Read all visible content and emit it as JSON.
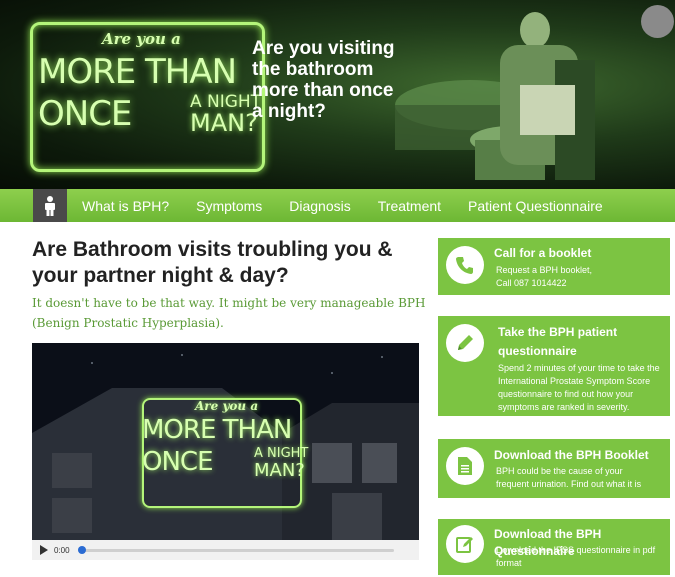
{
  "hero": {
    "slogan_small": "Are you a",
    "slogan_line1": "MORE THAN",
    "slogan_line2": "ONCE",
    "slogan_anight": "A NIGHT",
    "slogan_man": "MAN?",
    "question": "Are you visiting the bathroom more than once a night?"
  },
  "nav": {
    "home_icon": "person-icon",
    "items": [
      {
        "label": "What is BPH?"
      },
      {
        "label": "Symptoms"
      },
      {
        "label": "Diagnosis"
      },
      {
        "label": "Treatment"
      },
      {
        "label": "Patient Questionnaire"
      }
    ]
  },
  "main": {
    "headline": "Are Bathroom visits troubling you & your partner night & day?",
    "subline": "It doesn't have to be that way. It might be very manageable BPH (Benign Prostatic Hyperplasia).",
    "video": {
      "slogan_small": "Are you a",
      "slogan_line1": "MORE THAN",
      "slogan_line2": "ONCE",
      "slogan_anight": "A NIGHT",
      "slogan_man": "MAN?",
      "time": "0:00",
      "progress": 0
    }
  },
  "sidebar": {
    "cards": [
      {
        "icon": "phone-icon",
        "title": "Call for a booklet",
        "body_line1": "Request a BPH booklet,",
        "body_line2": "Call 087 1014422"
      },
      {
        "icon": "pencil-icon",
        "title_line1": "Take the BPH patient",
        "title_line2": "questionnaire",
        "body": "Spend 2 minutes of your time to take the International Prostate Symptom Score questionnaire to find out how your symptoms are ranked in severity."
      },
      {
        "icon": "document-icon",
        "title": "Download the BPH Booklet",
        "body": "BPH could be the cause of your frequent urination. Find out what it is"
      },
      {
        "icon": "edit-icon",
        "title": "Download the BPH Questionnaire",
        "body": "Download the IPSS questionnaire in pdf format"
      }
    ]
  },
  "colors": {
    "accent_green": "#7cc442",
    "nav_green": "#7dc242",
    "subline_green": "#5a9a36",
    "neon_green": "#b4f57a"
  }
}
